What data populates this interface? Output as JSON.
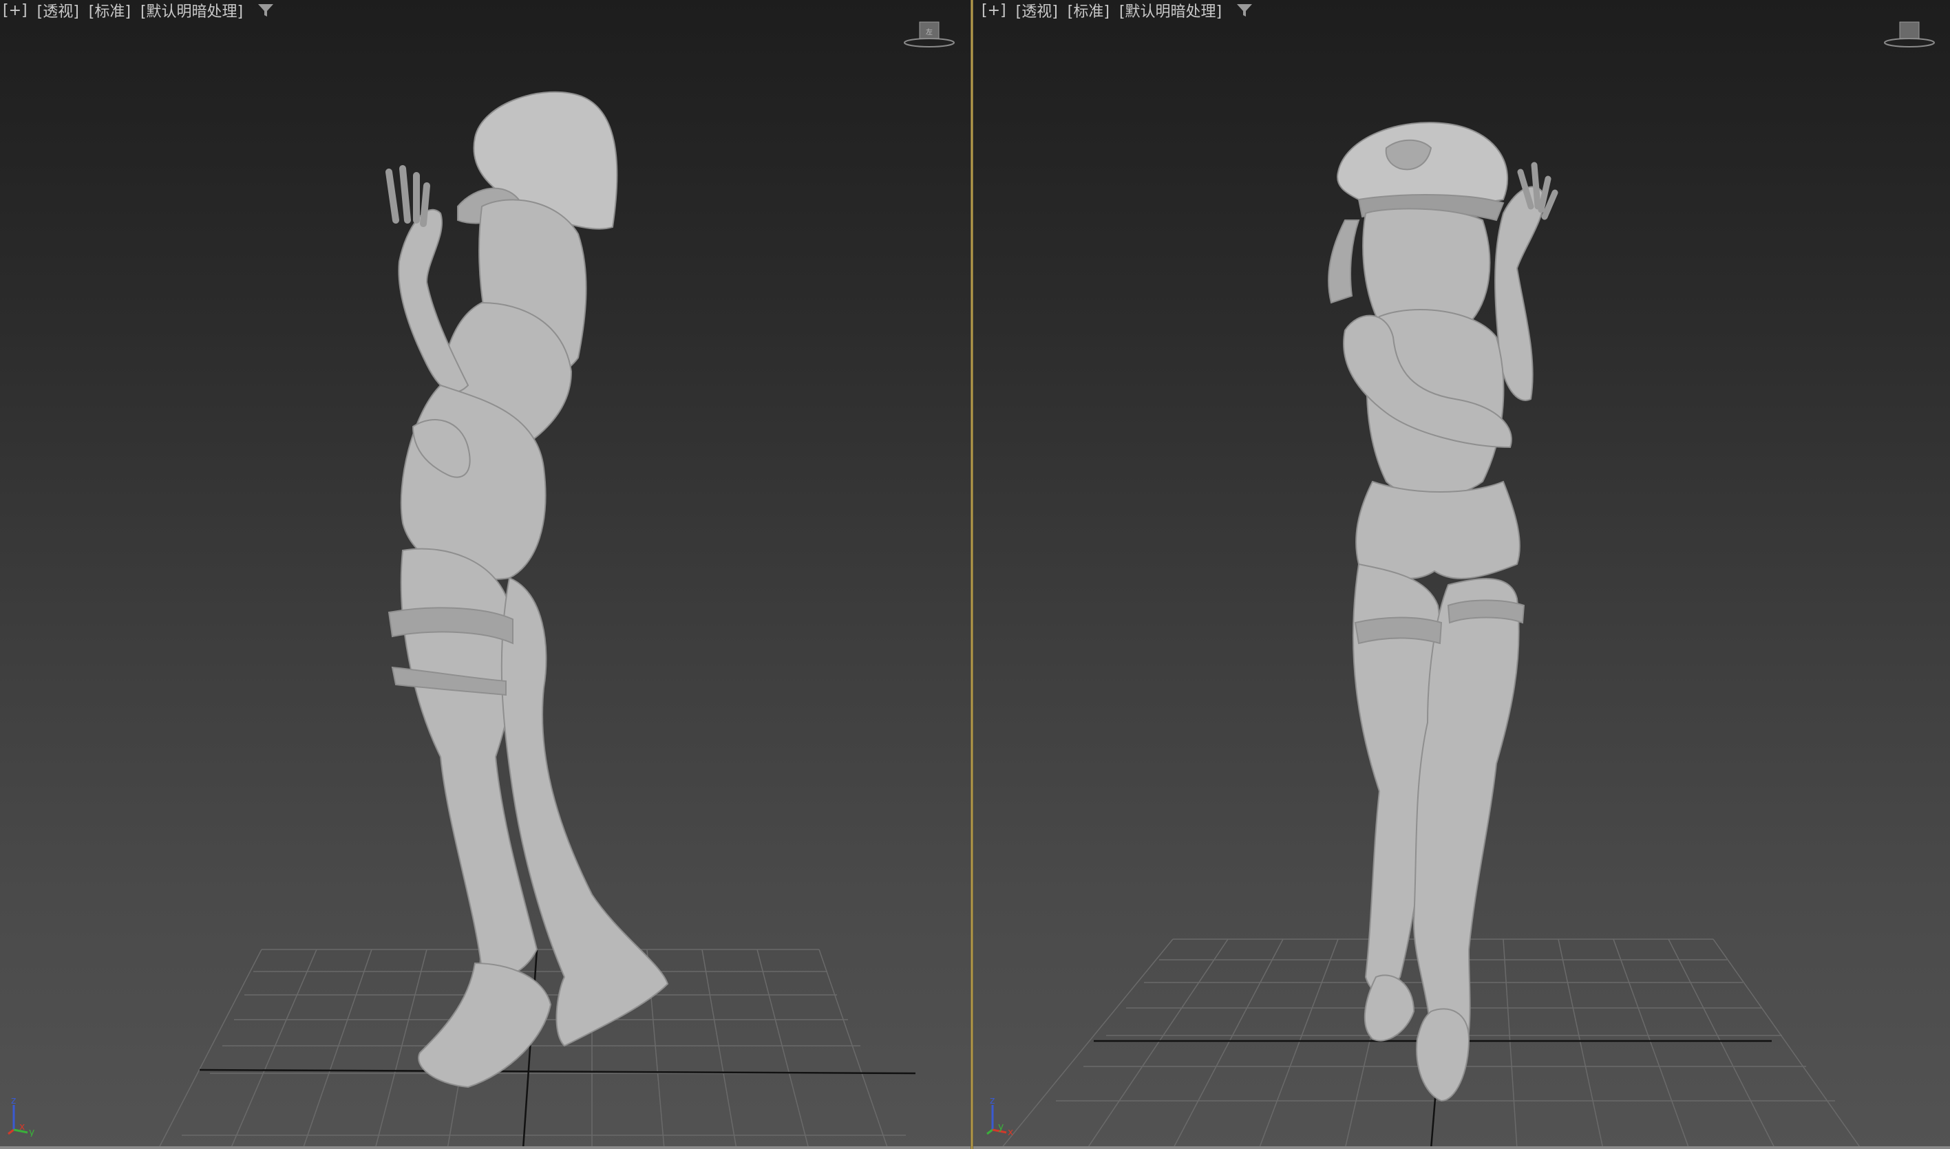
{
  "viewports": [
    {
      "id": "left",
      "labels": [
        "[+]",
        "[透视]",
        "[标准]",
        "[默认明暗处理]"
      ],
      "view": "perspective-side",
      "active": true
    },
    {
      "id": "right",
      "labels": [
        "[+]",
        "[透视]",
        "[标准]",
        "[默认明暗处理]"
      ],
      "view": "perspective-front",
      "active": false
    }
  ],
  "axis_left": {
    "z": "z",
    "x": "x",
    "y": "y"
  },
  "axis_right": {
    "z": "z",
    "y": "y",
    "x": "x"
  },
  "icons": {
    "filter": "filter-icon",
    "viewcube": "viewcube-icon",
    "tripod": "axis-tripod-icon"
  },
  "colors": {
    "label_text": "#c9c9c9",
    "grid_line": "#6a6a6a",
    "grid_axis": "#111111",
    "active_border": "#b49a4a",
    "model_fill": "#b8b8b8",
    "axis_x": "#d23a2a",
    "axis_y": "#3ab03a",
    "axis_z": "#3a5ad2"
  }
}
